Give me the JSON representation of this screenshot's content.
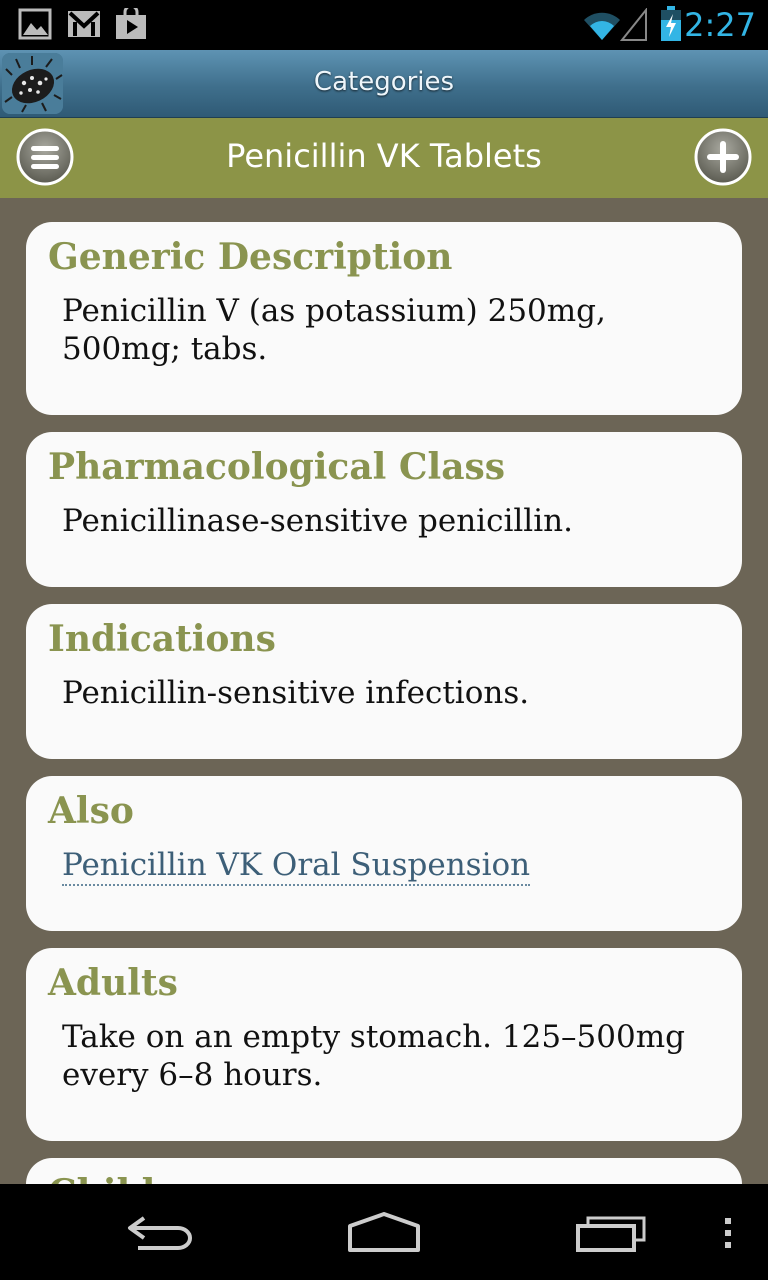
{
  "status_bar": {
    "time": "2:27",
    "icons": [
      "picture-icon",
      "gmail-icon",
      "play-store-icon",
      "wifi-icon",
      "signal-icon",
      "battery-charging-icon"
    ]
  },
  "title_bar": {
    "title": "Categories",
    "logo": "microbe-logo-icon"
  },
  "header": {
    "drug_name": "Penicillin VK Tablets",
    "menu_icon": "menu-icon",
    "add_icon": "add-icon"
  },
  "sections": [
    {
      "heading": "Generic Description",
      "body": "Penicillin V (as potassium) 250mg, 500mg; tabs."
    },
    {
      "heading": "Pharmacological Class",
      "body": "Penicillinase-sensitive penicillin."
    },
    {
      "heading": "Indications",
      "body": "Penicillin-sensitive infections."
    },
    {
      "heading": "Also",
      "link": "Penicillin VK Oral Suspension"
    },
    {
      "heading": "Adults",
      "body": "Take on an empty stomach. 125–500mg every 6–8 hours."
    },
    {
      "heading": "Children"
    }
  ],
  "nav_bar": {
    "icons": [
      "back-icon",
      "home-icon",
      "recent-apps-icon",
      "overflow-menu-icon"
    ]
  },
  "colors": {
    "accent_heading": "#8a9450",
    "header_bar": "#8c9447",
    "title_bar": "#3f6f8c",
    "background": "#6c6556",
    "status_accent": "#33b5e5"
  }
}
